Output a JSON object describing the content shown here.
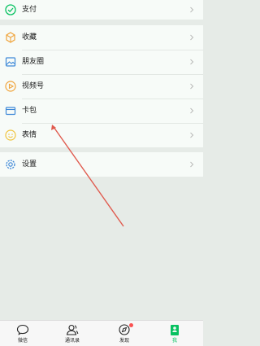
{
  "menu": {
    "pay": {
      "label": "支付",
      "icon": "pay-icon"
    },
    "items": [
      {
        "label": "收藏",
        "icon": "favorites-icon"
      },
      {
        "label": "朋友圈",
        "icon": "moments-icon"
      },
      {
        "label": "视频号",
        "icon": "channels-icon"
      },
      {
        "label": "卡包",
        "icon": "card-wallet-icon"
      },
      {
        "label": "表情",
        "icon": "sticker-icon"
      }
    ],
    "settings": {
      "label": "设置",
      "icon": "settings-icon"
    }
  },
  "tabbar": {
    "tabs": [
      {
        "label": "微信",
        "icon": "chats-icon",
        "active": false
      },
      {
        "label": "通讯录",
        "icon": "contacts-icon",
        "active": false
      },
      {
        "label": "发现",
        "icon": "discover-icon",
        "active": false,
        "badge": true
      },
      {
        "label": "我",
        "icon": "me-icon",
        "active": true
      }
    ]
  },
  "colors": {
    "accent": "#07c160",
    "badge": "#fa5151",
    "annotation_arrow": "#e05a4e",
    "background": "#e6ebe7",
    "panel": "#f7fbf8"
  }
}
